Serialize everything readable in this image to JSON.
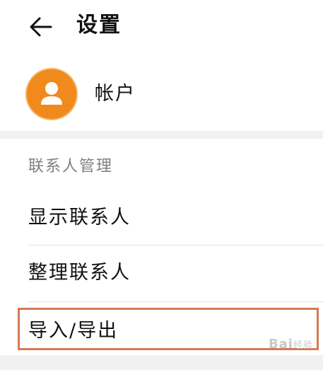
{
  "header": {
    "title": "设置",
    "back_icon": "arrow-left-icon"
  },
  "account": {
    "label": "帐户",
    "avatar_icon": "user-icon",
    "avatar_color": "#f08a1c"
  },
  "contacts_section": {
    "title": "联系人管理",
    "items": [
      {
        "label": "显示联系人"
      },
      {
        "label": "整理联系人"
      },
      {
        "label": "导入/导出"
      }
    ]
  },
  "highlight": {
    "color": "#d57a53"
  },
  "watermark": {
    "text": "Bai",
    "suffix": "经验"
  }
}
